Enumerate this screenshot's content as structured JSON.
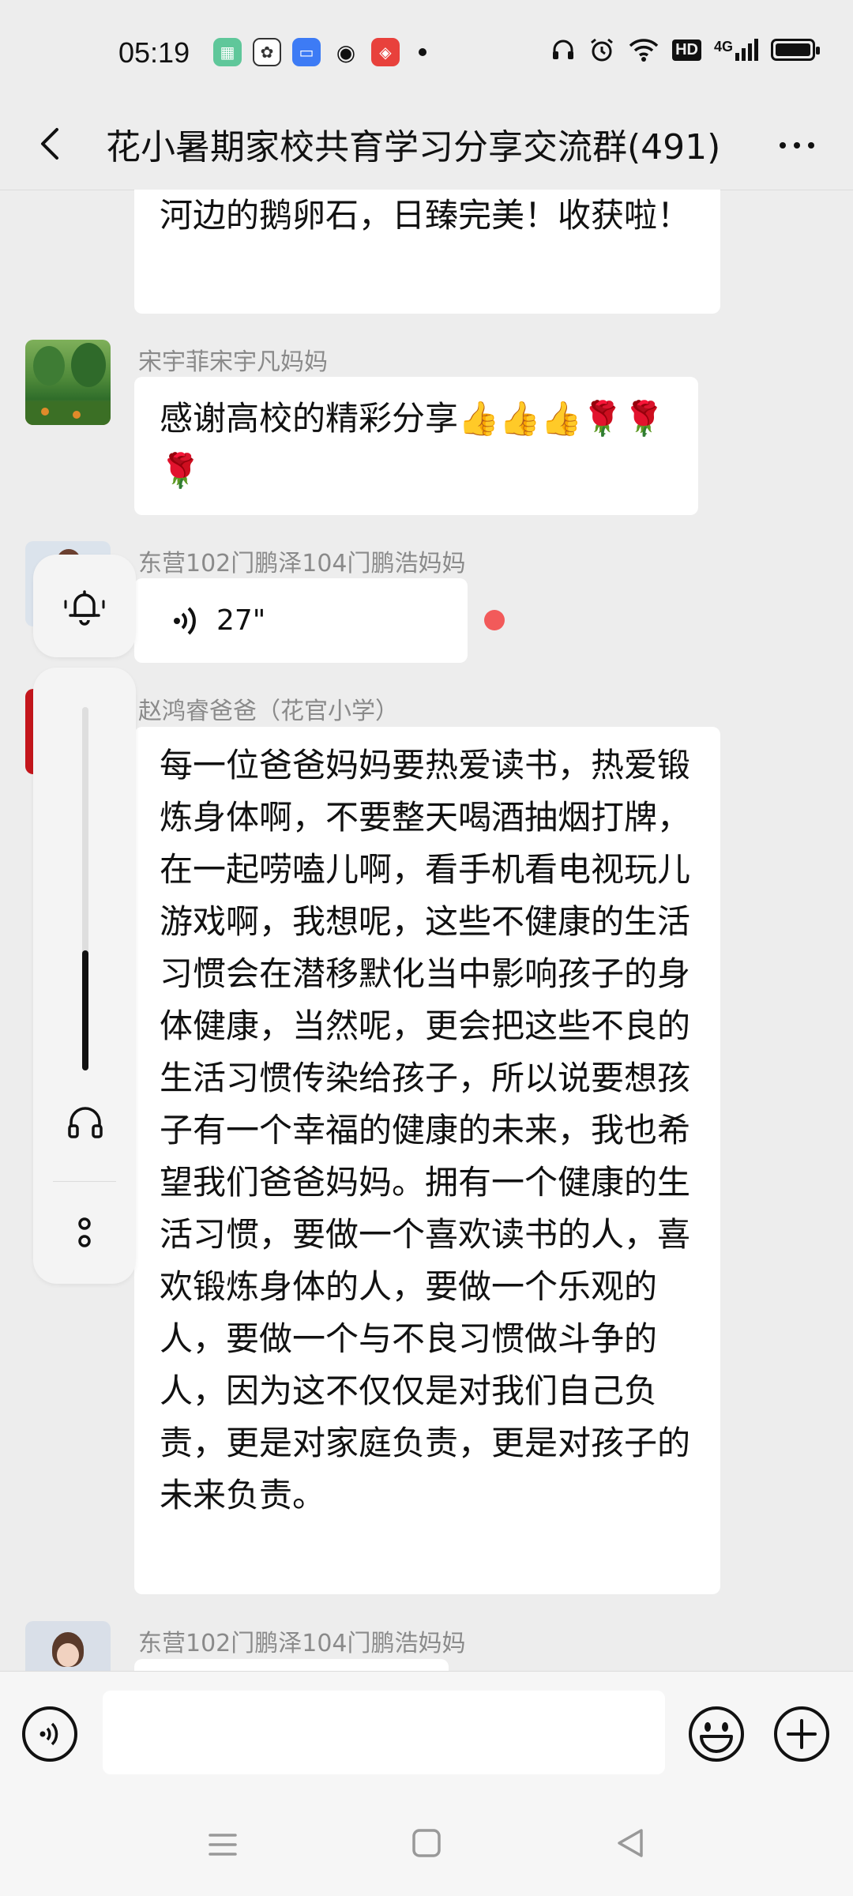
{
  "status_bar": {
    "time": "05:19",
    "network_label": "4G",
    "hd_label": "HD"
  },
  "header": {
    "title": "花小暑期家校共育学习分享交流群(491)"
  },
  "messages": [
    {
      "type": "text",
      "sender": "",
      "text": "河边的鹅卵石，日臻完美！收获啦！"
    },
    {
      "type": "text",
      "sender": "宋宇菲宋宇凡妈妈",
      "text": "感谢高校的精彩分享👍👍👍🌹🌹🌹"
    },
    {
      "type": "voice",
      "sender": "东营102门鹏泽104门鹏浩妈妈",
      "duration": "27\""
    },
    {
      "type": "text",
      "sender": "赵鸿睿爸爸（花官小学）",
      "text": "每一位爸爸妈妈要热爱读书，热爱锻炼身体啊，不要整天喝酒抽烟打牌，在一起唠嗑儿啊，看手机看电视玩儿游戏啊，我想呢，这些不健康的生活习惯会在潜移默化当中影响孩子的身体健康，当然呢，更会把这些不良的生活习惯传染给孩子，所以说要想孩子有一个幸福的健康的未来，我也希望我们爸爸妈妈。拥有一个健康的生活习惯，要做一个喜欢读书的人，喜欢锻炼身体的人，要做一个乐观的人，要做一个与不良习惯做斗争的人，因为这不仅仅是对我们自己负责，更是对家庭负责，更是对孩子的未来负责。"
    },
    {
      "type": "text",
      "sender": "东营102门鹏泽104门鹏浩妈妈",
      "text": ""
    }
  ],
  "floating_player": {
    "progress": 0.33
  },
  "input": {
    "placeholder": ""
  },
  "icons": {
    "back": "back-arrow-icon",
    "more": "more-icon",
    "bell": "bell-icon",
    "headphones": "headphones-icon",
    "voice": "voice-icon",
    "emoji": "emoji-icon",
    "plus": "plus-icon"
  },
  "colors": {
    "background": "#ededed",
    "bubble": "#ffffff",
    "unread_dot": "#f25a5a"
  }
}
